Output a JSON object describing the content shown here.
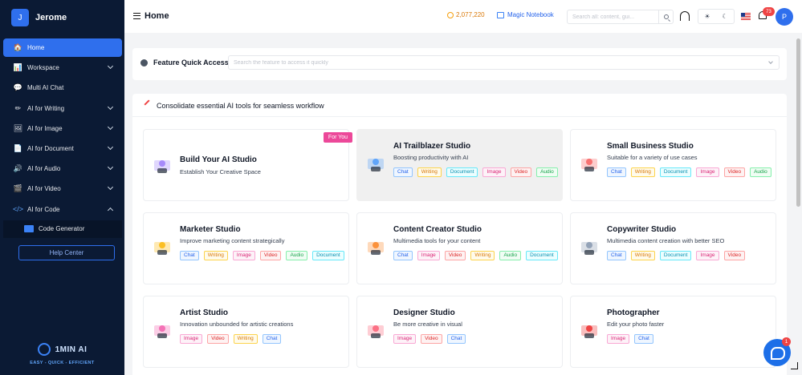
{
  "sidebar": {
    "avatar_letter": "J",
    "user_name": "Jerome",
    "items": [
      {
        "label": "Home",
        "icon": "home-icon"
      },
      {
        "label": "Workspace",
        "icon": "chart-icon"
      },
      {
        "label": "Multi AI Chat",
        "icon": "chat-icon"
      },
      {
        "label": "AI for Writing",
        "icon": "pencil-icon"
      },
      {
        "label": "AI for Image",
        "icon": "image-icon"
      },
      {
        "label": "AI for Document",
        "icon": "document-icon"
      },
      {
        "label": "AI for Audio",
        "icon": "speaker-icon"
      },
      {
        "label": "AI for Video",
        "icon": "video-icon"
      },
      {
        "label": "AI for Code",
        "icon": "code-icon"
      }
    ],
    "sub_item": {
      "label": "Code Generator",
      "icon": "code-generator-icon"
    },
    "help_center": "Help Center",
    "logo_text": "1MIN AI",
    "logo_tagline": "EASY - QUICK - EFFICIENT"
  },
  "header": {
    "title": "Home",
    "credits": "2,077,220",
    "magic_notebook": "Magic Notebook",
    "search_placeholder": "Search all: content, gui...",
    "theme_light": "☀",
    "theme_dark": "☾",
    "notification_count": "73",
    "user_initial": "P"
  },
  "quick_access": {
    "title": "Feature Quick Access",
    "placeholder": "Search the feature to access it quickly"
  },
  "panel": {
    "title": "Consolidate essential AI tools for seamless workflow",
    "for_you_badge": "For You",
    "cards": [
      {
        "title": "Build Your AI Studio",
        "desc": "Establish Your Creative Space",
        "tags": []
      },
      {
        "title": "AI Trailblazer Studio",
        "desc": "Boosting productivity with AI",
        "tags": [
          "Chat",
          "Writing",
          "Document",
          "Image",
          "Video",
          "Audio"
        ]
      },
      {
        "title": "Small Business Studio",
        "desc": "Suitable for a variety of use cases",
        "tags": [
          "Chat",
          "Writing",
          "Document",
          "Image",
          "Video",
          "Audio"
        ]
      },
      {
        "title": "Marketer Studio",
        "desc": "Improve marketing content strategically",
        "tags": [
          "Chat",
          "Writing",
          "Image",
          "Video",
          "Audio",
          "Document"
        ]
      },
      {
        "title": "Content Creator Studio",
        "desc": "Multimedia tools for your content",
        "tags": [
          "Chat",
          "Image",
          "Video",
          "Writing",
          "Audio",
          "Document"
        ]
      },
      {
        "title": "Copywriter Studio",
        "desc": "Multimedia content creation with better SEO",
        "tags": [
          "Chat",
          "Writing",
          "Document",
          "Image",
          "Video"
        ]
      },
      {
        "title": "Artist Studio",
        "desc": "Innovation unbounded for artistic creations",
        "tags": [
          "Image",
          "Video",
          "Writing",
          "Chat"
        ]
      },
      {
        "title": "Designer Studio",
        "desc": "Be more creative in visual",
        "tags": [
          "Image",
          "Video",
          "Chat"
        ]
      },
      {
        "title": "Photographer",
        "desc": "Edit your photo faster",
        "tags": [
          "Image",
          "Chat"
        ]
      }
    ]
  },
  "chat_widget": {
    "badge": "1"
  }
}
